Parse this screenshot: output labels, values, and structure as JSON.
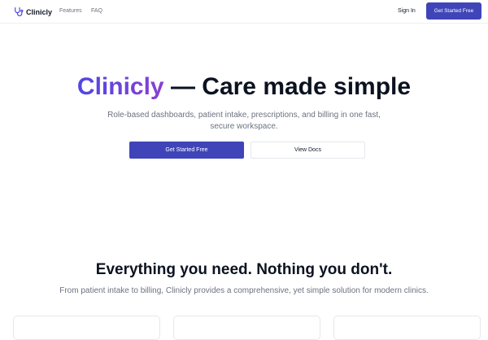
{
  "nav": {
    "brand": "Clinicly",
    "brand_icon": "stethoscope-icon",
    "links": [
      "Features",
      "FAQ"
    ],
    "sign_in": "Sign In",
    "cta": "Get Started Free"
  },
  "hero": {
    "title_brand": "Clinicly",
    "title_rest": " — Care made simple",
    "subtitle": "Role-based dashboards, patient intake, prescriptions, and billing in one fast, secure workspace.",
    "primary_button": "Get Started Free",
    "secondary_button": "View Docs"
  },
  "features": {
    "title": "Everything you need. Nothing you don't.",
    "subtitle": "From patient intake to billing, Clinicly provides a comprehensive, yet simple solution for modern clinics."
  },
  "colors": {
    "accent": "#3f45b8",
    "gradient_start": "#4f46e5",
    "gradient_end": "#8b3fd1"
  }
}
